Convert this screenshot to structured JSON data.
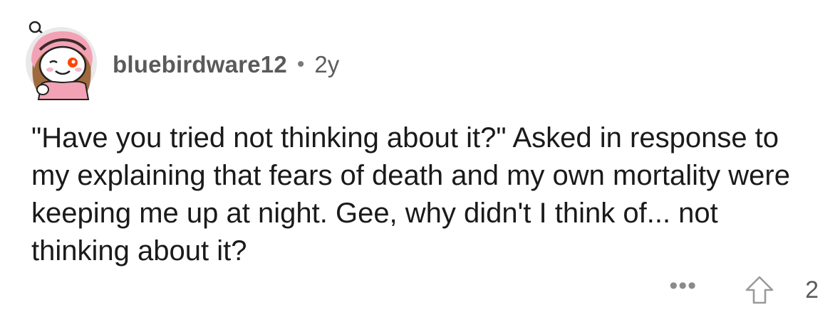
{
  "comment": {
    "username": "bluebirdware12",
    "separator": "•",
    "age": "2y",
    "body": "\"Have you tried not thinking about it?\" Asked in response to my explaining that fears of death and my own mortality were keeping me up at night. Gee, why didn't I think of... not thinking about it?",
    "more_label": "•••",
    "score": "2"
  },
  "icons": {
    "avatar": "snoo-avatar",
    "more": "more-options-icon",
    "upvote": "upvote-arrow-icon"
  },
  "colors": {
    "background": "#ffffff",
    "text": "#1a1a1a",
    "meta": "#5c5c5c",
    "avatar_accent": "#f3a2b5",
    "avatar_eye": "#ff4500"
  }
}
